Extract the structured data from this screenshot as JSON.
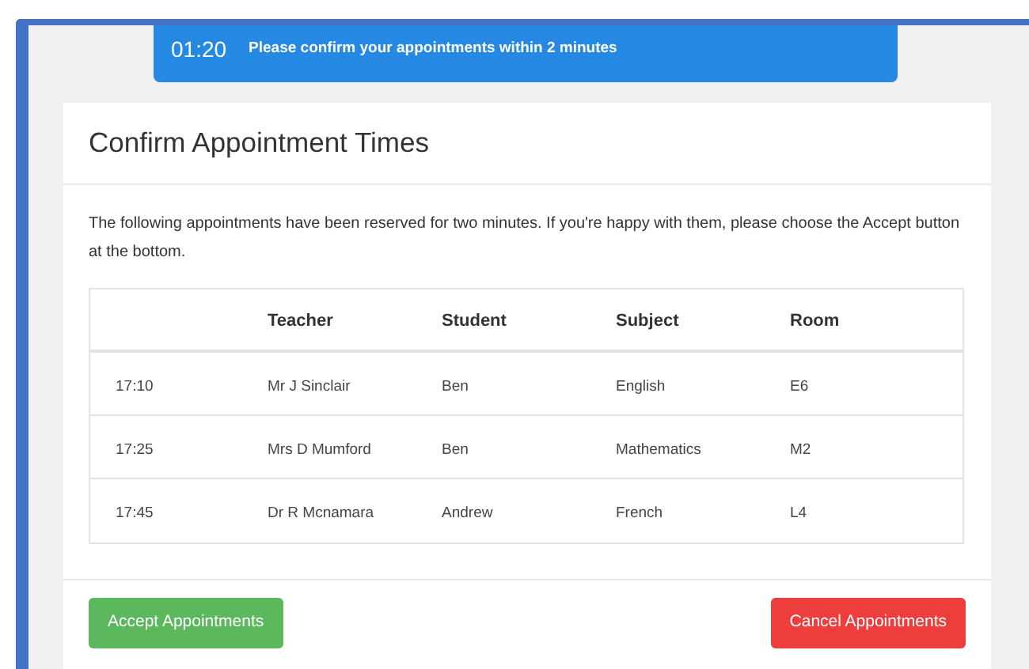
{
  "banner": {
    "timer": "01:20",
    "message": "Please confirm your appointments within 2 minutes"
  },
  "card": {
    "title": "Confirm Appointment Times",
    "intro": "The following appointments have been reserved for two minutes. If you're happy with them, please choose the Accept button at the bottom.",
    "table": {
      "columns": [
        "",
        "Teacher",
        "Student",
        "Subject",
        "Room"
      ],
      "rows": [
        [
          "17:10",
          "Mr J Sinclair",
          "Ben",
          "English",
          "E6"
        ],
        [
          "17:25",
          "Mrs D Mumford",
          "Ben",
          "Mathematics",
          "M2"
        ],
        [
          "17:45",
          "Dr R Mcnamara",
          "Andrew",
          "French",
          "L4"
        ]
      ]
    },
    "buttons": [
      {
        "label": "Accept Appointments",
        "kind": "accept"
      },
      {
        "label": "Cancel Appointments",
        "kind": "cancel"
      }
    ]
  }
}
